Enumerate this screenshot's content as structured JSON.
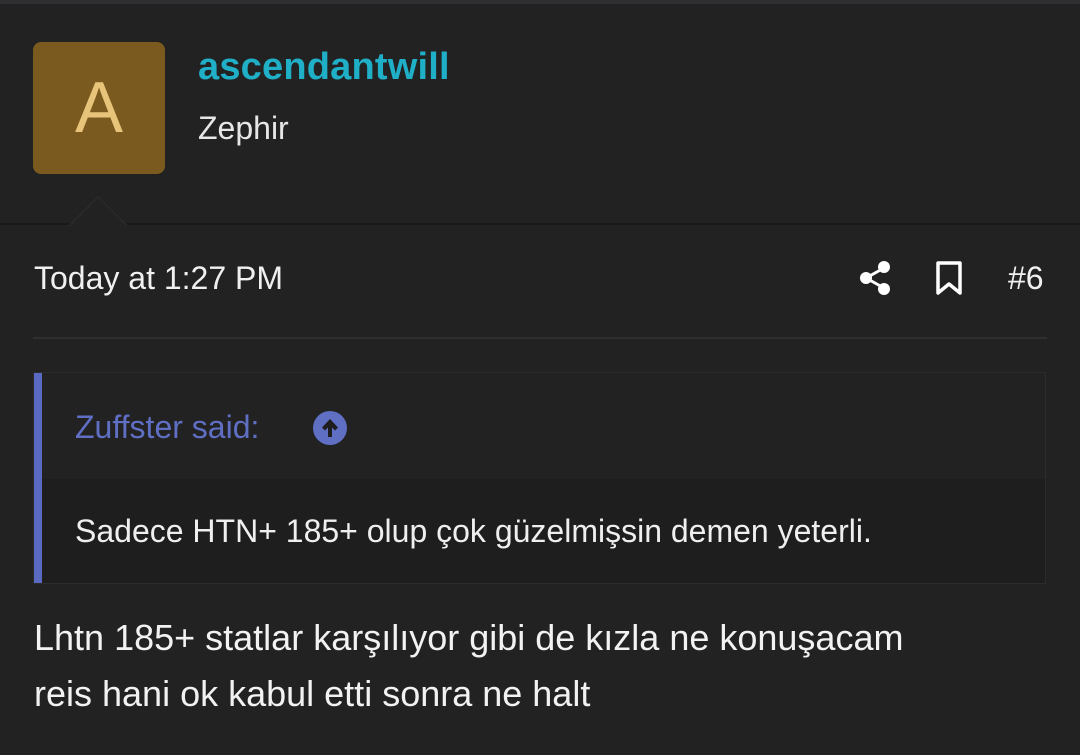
{
  "user": {
    "avatar_letter": "A",
    "username": "ascendantwill",
    "title": "Zephir",
    "avatar_color": "#7a5a1f",
    "username_color": "#1fb0c8"
  },
  "post": {
    "timestamp": "Today at 1:27 PM",
    "number": "#6",
    "icons": [
      "share-icon",
      "bookmark-icon"
    ]
  },
  "quote": {
    "attribution": "Zuffster said:",
    "text": "Sadece HTN+ 185+ olup çok güzelmişsin demen yeterli.",
    "accent_color": "#5b6ac1",
    "jump_icon": "arrow-up-circle-icon"
  },
  "body": {
    "line1": "Lhtn 185+ statlar karşılıyor gibi de kızla ne konuşacam",
    "line2": "reis hani ok kabul etti sonra ne halt"
  }
}
